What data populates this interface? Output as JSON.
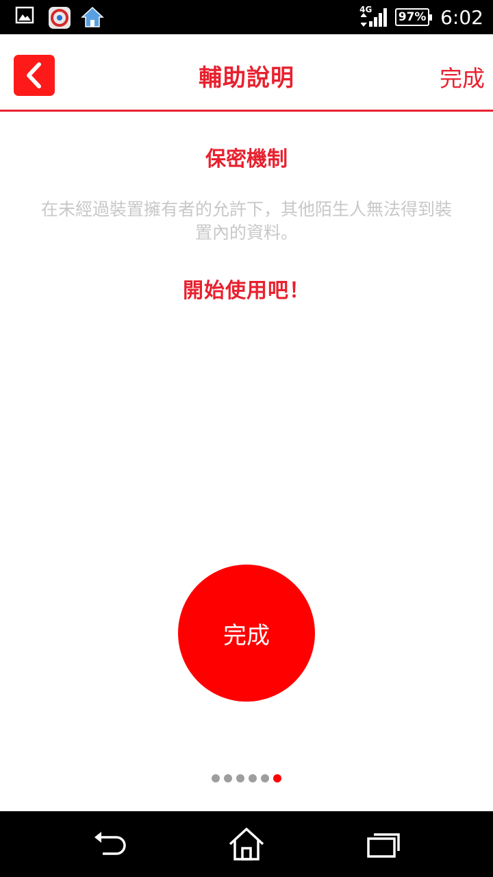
{
  "status_bar": {
    "network": "4G",
    "battery": "97%",
    "time": "6:02",
    "icons": [
      "gallery-icon",
      "app-notification-icon",
      "home-app-icon"
    ]
  },
  "header": {
    "title": "輔助說明",
    "done_label": "完成",
    "back_icon": "chevron-left-icon"
  },
  "content": {
    "section_title": "保密機制",
    "description": "在未經過裝置擁有者的允許下，其他陌生人無法得到裝置內的資料。",
    "cta": "開始使用吧！",
    "done_button": "完成"
  },
  "pager": {
    "total": 6,
    "active": 6
  },
  "nav_bar": {
    "icons": [
      "back-nav-icon",
      "home-nav-icon",
      "recents-nav-icon"
    ]
  },
  "colors": {
    "accent": "#e8212f",
    "button": "#ff0000",
    "muted_text": "#c8c8c8"
  }
}
